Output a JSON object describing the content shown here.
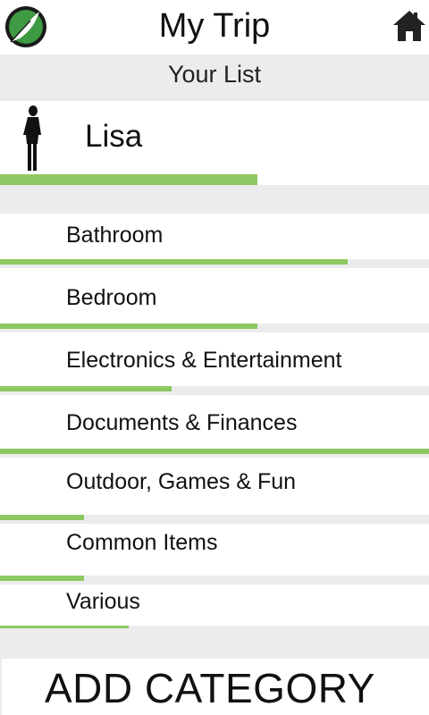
{
  "header": {
    "title": "My Trip"
  },
  "subheader": {
    "title": "Your List"
  },
  "person": {
    "name": "Lisa",
    "progress": 0.6
  },
  "categories": [
    {
      "label": "Bathroom",
      "progress": 0.81
    },
    {
      "label": "Bedroom",
      "progress": 0.6
    },
    {
      "label": "Electronics & Entertainment",
      "progress": 0.4
    },
    {
      "label": "Documents & Finances",
      "progress": 1.0
    },
    {
      "label": "Outdoor, Games & Fun",
      "progress": 0.195
    },
    {
      "label": "Common Items",
      "progress": 0.195
    },
    {
      "label": "Various",
      "progress": 0.3
    }
  ],
  "footer": {
    "add_label": "ADD CATEGORY"
  },
  "colors": {
    "accent": "#8dc863",
    "band": "#ececec",
    "logo_green": "#1f7a3a"
  },
  "icons": {
    "logo": "feather-logo-icon",
    "home": "home-icon",
    "person": "person-silhouette-icon"
  }
}
